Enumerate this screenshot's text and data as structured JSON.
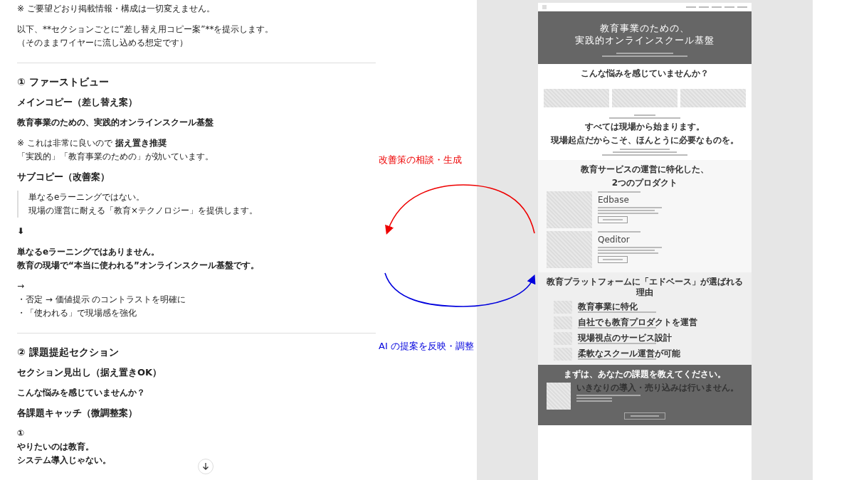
{
  "chat": {
    "blocks": [
      {
        "kind": "para",
        "lines": [
          "※ ご要望どおり掲載情報・構成は一切変えません。"
        ]
      },
      {
        "kind": "para",
        "lines": [
          "以下、**セクションごとに“差し替え用コピー案”**を提示します。",
          "（そのままワイヤーに流し込める想定です）"
        ]
      },
      {
        "kind": "rule"
      },
      {
        "kind": "h2",
        "lines": [
          "① ファーストビュー"
        ]
      },
      {
        "kind": "h3",
        "lines": [
          "メインコピー（差し替え案）"
        ]
      },
      {
        "kind": "bold",
        "lines": [
          "教育事業のための、実践的オンラインスクール基盤"
        ]
      },
      {
        "kind": "rich",
        "lines": [
          "※ これは非常に良いので **据え置き推奨**",
          "「実践的」「教育事業のための」が効いています。"
        ]
      },
      {
        "kind": "h3",
        "lines": [
          "サブコピー（改善案）"
        ]
      },
      {
        "kind": "quote",
        "lines": [
          "単なるeラーニングではない。",
          "現場の運営に耐える「教育×テクノロジー」を提供します。"
        ]
      },
      {
        "kind": "bold",
        "lines": [
          "⬇"
        ]
      },
      {
        "kind": "bold",
        "lines": [
          "単なるeラーニングではありません。",
          "教育の現場で“本当に使われる”オンラインスクール基盤です。"
        ]
      },
      {
        "kind": "para",
        "lines": [
          "→",
          "・否定 → 価値提示 のコントラストを明確に",
          "・「使われる」で現場感を強化"
        ]
      },
      {
        "kind": "rule"
      },
      {
        "kind": "h2",
        "lines": [
          "② 課題提起セクション"
        ]
      },
      {
        "kind": "h3",
        "lines": [
          "セクション見出し（据え置きOK）"
        ]
      },
      {
        "kind": "bold",
        "lines": [
          "こんな悩みを感じていませんか？"
        ]
      },
      {
        "kind": "h3",
        "lines": [
          "各課題キャッチ（微調整案）"
        ]
      },
      {
        "kind": "bold",
        "lines": [
          "①",
          "やりたいのは教育。",
          "システム導入じゃない。"
        ]
      }
    ]
  },
  "cycle": {
    "top_label": "改善策の相談・生成",
    "bottom_label": "AI の提案を反映・調整"
  },
  "wireframe": {
    "hero_title": [
      "教育事業のための、",
      "実践的オンラインスクール基盤"
    ],
    "problems_title": "こんな悩みを感じていませんか？",
    "message": [
      "すべては現場から始まります。",
      "現場起点だからこそ、ほんとうに必要なものを。"
    ],
    "products_title": [
      "教育サービスの運営に特化した、",
      "2つのプロダクト"
    ],
    "products": [
      {
        "name": "Edbase"
      },
      {
        "name": "Qeditor"
      }
    ],
    "reasons_title": "教育プラットフォームに「エドベース」が選ばれる理由",
    "reasons": [
      {
        "title": "教育事業に特化"
      },
      {
        "title": "自社でも教育プロダクトを運営"
      },
      {
        "title": "現場視点のサービス設計"
      },
      {
        "title": "柔軟なスクール運営が可能"
      }
    ],
    "cta_title": "まずは、あなたの課題を教えてください。",
    "cta_subtitle": "いきなりの導入・売り込みは行いません。"
  }
}
